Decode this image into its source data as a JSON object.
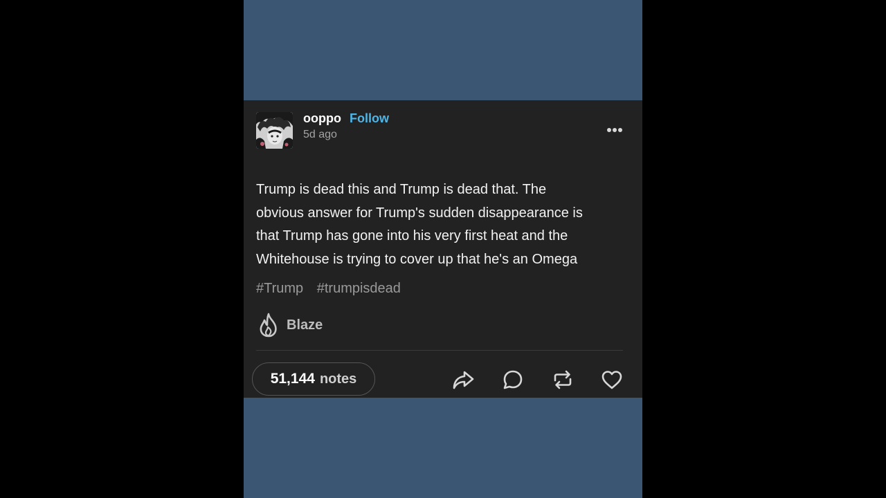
{
  "post": {
    "username": "ooppo",
    "follow_label": "Follow",
    "timestamp": "5d ago",
    "more_icon": "more-horizontal-icon",
    "body_lines": [
      "Trump is dead this and Trump is dead that. The",
      "obvious answer for Trump's sudden disappearance is",
      "that Trump has gone into his very first heat and the",
      "Whitehouse is trying to cover up that he's an Omega"
    ],
    "tags": [
      "#Trump",
      "#trumpisdead"
    ],
    "blaze_label": "Blaze",
    "notes_count": "51,144",
    "notes_label": "notes",
    "actions": {
      "share_icon": "share-icon",
      "reply_icon": "reply-icon",
      "reblog_icon": "reblog-icon",
      "like_icon": "heart-icon"
    }
  },
  "colors": {
    "background": "#3b5673",
    "card": "#222222",
    "follow": "#4fb5e6",
    "text": "#f2f2f2",
    "muted": "#9a9a9a"
  }
}
